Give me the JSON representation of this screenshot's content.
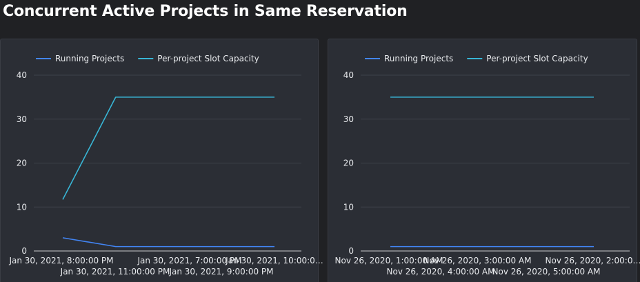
{
  "page": {
    "title": "Concurrent Active Projects in Same Reservation"
  },
  "colors": {
    "running": "#4285f4",
    "capacity": "#38b6d6",
    "grid": "#3e424b",
    "axis": "#c8cacd"
  },
  "chart_data": [
    {
      "type": "line",
      "ylim": [
        0,
        40
      ],
      "yticks": [
        0,
        10,
        20,
        30,
        40
      ],
      "x_labels_row1": [
        "Jan 30, 2021, 8:00:00 PM",
        "Jan 30, 2021, 7:00:00 PM",
        "Jan 30, 2021, 10:00:0…"
      ],
      "x_labels_row2": [
        "Jan 30, 2021, 11:00:00 PM",
        "Jan 30, 2021, 9:00:00 PM"
      ],
      "x": [
        "Jan 30, 2021, 8:00:00 PM",
        "Jan 30, 2021, 11:00:00 PM",
        "Jan 30, 2021, 7:00:00 PM",
        "Jan 30, 2021, 9:00:00 PM",
        "Jan 30, 2021, 10:00:0…"
      ],
      "series": [
        {
          "name": "Running Projects",
          "color": "#4285f4",
          "values": [
            3,
            1,
            1,
            1,
            1
          ]
        },
        {
          "name": "Per-project Slot Capacity",
          "color": "#38b6d6",
          "values": [
            11.7,
            35,
            35,
            35,
            35
          ]
        }
      ]
    },
    {
      "type": "line",
      "ylim": [
        0,
        40
      ],
      "yticks": [
        0,
        10,
        20,
        30,
        40
      ],
      "x_labels_row1": [
        "Nov 26, 2020, 1:00:00 AM",
        "Nov 26, 2020, 3:00:00 AM",
        "Nov 26, 2020, 2:00:0…"
      ],
      "x_labels_row2": [
        "Nov 26, 2020, 4:00:00 AM",
        "Nov 26, 2020, 5:00:00 AM"
      ],
      "x": [
        "Nov 26, 2020, 1:00:00 AM",
        "Nov 26, 2020, 4:00:00 AM",
        "Nov 26, 2020, 3:00:00 AM",
        "Nov 26, 2020, 5:00:00 AM",
        "Nov 26, 2020, 2:00:0…"
      ],
      "series": [
        {
          "name": "Running Projects",
          "color": "#4285f4",
          "values": [
            1,
            1,
            1,
            1,
            1
          ]
        },
        {
          "name": "Per-project Slot Capacity",
          "color": "#38b6d6",
          "values": [
            35,
            35,
            35,
            35,
            35
          ]
        }
      ]
    }
  ]
}
